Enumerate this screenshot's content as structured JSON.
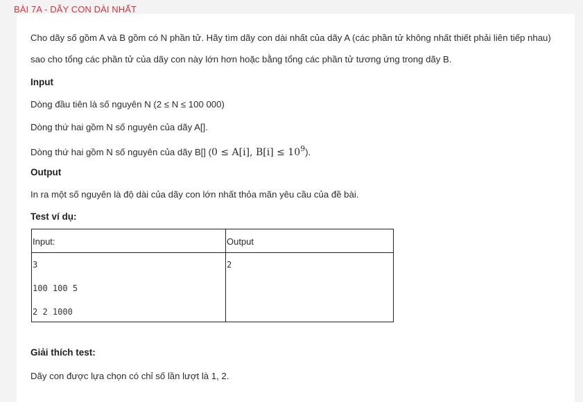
{
  "page_title": "BÀI 7A - DÃY CON DÀI NHẤT",
  "statement": {
    "line1": "Cho dãy số gồm A và B gồm có N phần tử. Hãy tìm dãy con dài nhất của dãy A (các phần tử không nhất thiết phải liên tiếp nhau)",
    "line2": "sao cho tổng các phần tử của dãy con này lớn hơn hoặc bằng tổng các phần tử tương ứng trong dãy B."
  },
  "input_section": {
    "heading": "Input",
    "line1": "Dòng đầu tiên là số nguyên N (2 ≤ N ≤ 100 000)",
    "line2": "Dòng thứ hai gồm N số nguyên của dãy A[].",
    "line3_text": "Dòng thứ hai gồm N số nguyên của dãy B[] (",
    "line3_math": "0 ≤ A[i], B[i] ≤ 10",
    "line3_exponent": "9",
    "line3_end": ")."
  },
  "output_section": {
    "heading": "Output",
    "line1": "In ra một số nguyên là độ dài của dãy con lớn nhất thỏa mãn yêu cầu của đề bài."
  },
  "test_section": {
    "heading": "Test ví dụ:",
    "table": {
      "headers": [
        "Input:",
        "Output"
      ],
      "input_lines": [
        "3",
        "100 100 5",
        "2 2 1000"
      ],
      "output_lines": [
        "2"
      ]
    }
  },
  "explanation_section": {
    "heading": "Giải thích test:",
    "line1": "Dãy con được lựa chọn có chỉ số lần lượt là 1, 2."
  }
}
